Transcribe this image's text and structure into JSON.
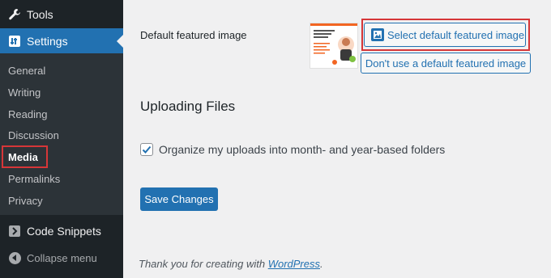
{
  "sidebar": {
    "tools_label": "Tools",
    "settings_label": "Settings",
    "submenu": [
      "General",
      "Writing",
      "Reading",
      "Discussion",
      "Media",
      "Permalinks",
      "Privacy"
    ],
    "current": "Media",
    "code_snippets_label": "Code Snippets",
    "collapse_label": "Collapse menu"
  },
  "featured": {
    "label": "Default featured image",
    "select_button": "Select default featured image",
    "dont_button": "Don't use a default featured image",
    "thumb_text": "ns and Cons of Yoast SEO"
  },
  "uploading": {
    "heading": "Uploading Files",
    "checkbox_label": "Organize my uploads into month- and year-based folders",
    "checked": true
  },
  "save_button": "Save Changes",
  "footer": {
    "text": "Thank you for creating with",
    "link": "WordPress",
    "suffix": "."
  },
  "colors": {
    "admin_dark": "#1d2327",
    "accent_blue": "#2271b1",
    "highlight_red": "#d63638"
  }
}
